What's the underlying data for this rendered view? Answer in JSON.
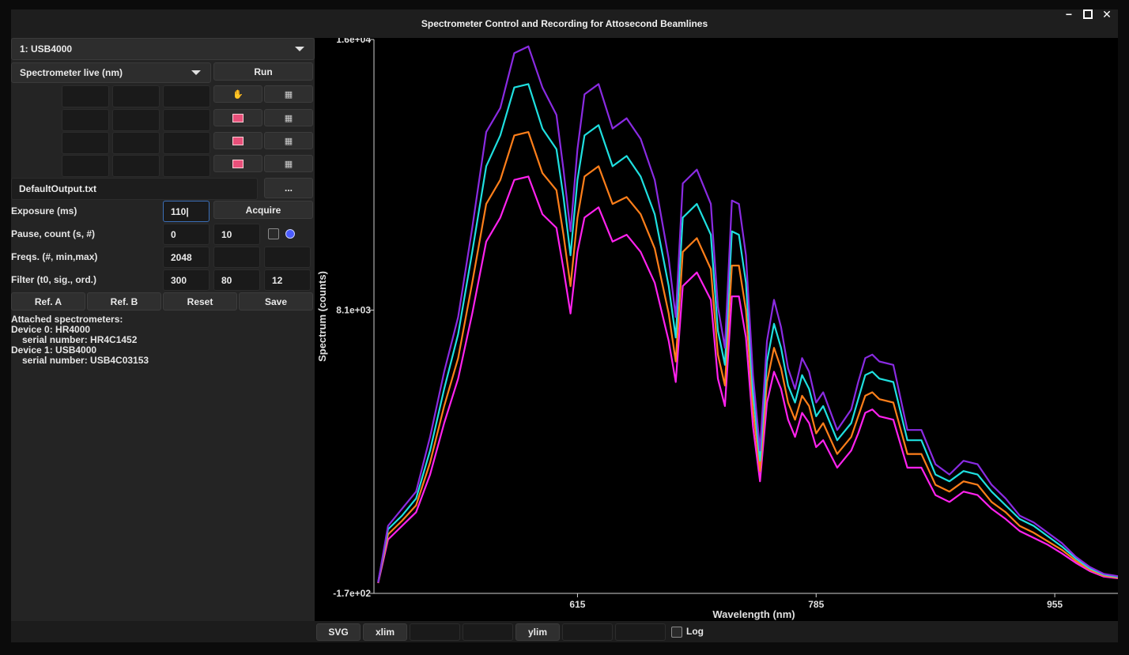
{
  "window": {
    "title": "Spectrometer Control and Recording for Attosecond Beamlines"
  },
  "device_select": {
    "value": "1: USB4000"
  },
  "mode_select": {
    "value": "Spectrometer live (nm)"
  },
  "run_label": "Run",
  "output_file": {
    "value": "DefaultOutput.txt",
    "browse_label": "..."
  },
  "exposure": {
    "label": "Exposure (ms)",
    "value": "110|",
    "acquire_label": "Acquire"
  },
  "pause": {
    "label": "Pause, count (s, #)",
    "seconds": "0",
    "count": "10"
  },
  "freqs": {
    "label": "Freqs. (#, min,max)",
    "n": "2048",
    "min": "",
    "max": ""
  },
  "filter": {
    "label": "Filter (t0, sig., ord.)",
    "t0": "300",
    "sigma": "80",
    "order": "12"
  },
  "buttons": {
    "ref_a": "Ref. A",
    "ref_b": "Ref. B",
    "reset": "Reset",
    "save": "Save"
  },
  "info": {
    "line1": "Attached spectrometers:",
    "line2": "Device 0: HR4000",
    "line3": "serial number: HR4C1452",
    "line4": "Device 1: USB4000",
    "line5": "serial number: USB4C03153"
  },
  "bottom": {
    "svg": "SVG",
    "xlim": "xlim",
    "ylim": "ylim",
    "log": "Log"
  },
  "colors": {
    "purple": "#8a2be2",
    "cyan": "#1fe0e0",
    "orange": "#ff7f1a",
    "magenta": "#ff22ee"
  },
  "chart_data": {
    "type": "line",
    "xlabel": "Wavelength (nm)",
    "ylabel": "Spectrum (counts)",
    "xlim": [
      470,
      1000
    ],
    "ylim": [
      -170,
      16000
    ],
    "x_ticks": [
      615,
      785,
      955
    ],
    "y_tick_labels": [
      "1.6e+04",
      "8.1e+03",
      "-1.7e+02"
    ],
    "y_ticks": [
      16000,
      8100,
      -170
    ],
    "x": [
      473,
      480,
      490,
      500,
      510,
      520,
      530,
      540,
      550,
      560,
      570,
      580,
      590,
      600,
      605,
      610,
      615,
      620,
      630,
      640,
      650,
      660,
      670,
      680,
      685,
      690,
      700,
      710,
      715,
      720,
      725,
      730,
      735,
      740,
      745,
      750,
      755,
      760,
      765,
      770,
      775,
      780,
      785,
      790,
      800,
      810,
      815,
      820,
      825,
      830,
      840,
      850,
      860,
      870,
      880,
      890,
      900,
      910,
      920,
      930,
      940,
      950,
      960,
      970,
      980,
      990,
      1000
    ],
    "series": [
      {
        "values": [
          150,
          1800,
          2300,
          2800,
          4400,
          6300,
          7900,
          10500,
          13300,
          14000,
          15600,
          15800,
          14600,
          13800,
          12200,
          10400,
          12800,
          14400,
          14700,
          13400,
          13700,
          13100,
          11900,
          9600,
          7900,
          11800,
          12200,
          11200,
          8200,
          7000,
          11300,
          11200,
          9700,
          6200,
          4000,
          7200,
          8400,
          7600,
          6400,
          5800,
          6700,
          6300,
          5400,
          5700,
          4600,
          5200,
          6000,
          6700,
          6800,
          6600,
          6500,
          4600,
          4600,
          3600,
          3300,
          3700,
          3600,
          3000,
          2600,
          2100,
          1900,
          1600,
          1300,
          900,
          600,
          400,
          330
        ]
      },
      {
        "values": [
          150,
          1700,
          2100,
          2600,
          4000,
          5800,
          7400,
          9800,
          12300,
          13200,
          14600,
          14700,
          13400,
          12800,
          11400,
          9700,
          11900,
          13200,
          13500,
          12300,
          12600,
          12000,
          10900,
          8800,
          7300,
          10800,
          11200,
          10300,
          7500,
          6500,
          10400,
          10300,
          8900,
          5700,
          3700,
          6600,
          7700,
          7000,
          5900,
          5400,
          6200,
          5800,
          5000,
          5300,
          4300,
          4800,
          5500,
          6200,
          6300,
          6100,
          6000,
          4300,
          4300,
          3300,
          3100,
          3400,
          3300,
          2800,
          2400,
          2000,
          1800,
          1500,
          1200,
          850,
          560,
          380,
          310
        ]
      },
      {
        "values": [
          140,
          1550,
          1950,
          2400,
          3650,
          5300,
          6700,
          8900,
          11200,
          11900,
          13200,
          13300,
          12100,
          11600,
          10300,
          8800,
          10800,
          12000,
          12300,
          11200,
          11400,
          10900,
          9900,
          8000,
          6600,
          9800,
          10200,
          9300,
          6800,
          5900,
          9400,
          9400,
          8100,
          5200,
          3400,
          6000,
          7000,
          6400,
          5400,
          4900,
          5600,
          5300,
          4500,
          4800,
          3900,
          4400,
          5000,
          5600,
          5700,
          5500,
          5400,
          3900,
          3900,
          3000,
          2800,
          3100,
          3000,
          2500,
          2200,
          1800,
          1600,
          1350,
          1100,
          780,
          520,
          350,
          290
        ]
      },
      {
        "values": [
          130,
          1400,
          1800,
          2200,
          3300,
          4800,
          6100,
          8000,
          10100,
          10800,
          11900,
          12000,
          10900,
          10500,
          9300,
          8000,
          9800,
          10800,
          11100,
          10100,
          10300,
          9800,
          8900,
          7200,
          6000,
          8800,
          9200,
          8400,
          6100,
          5300,
          8500,
          8500,
          7300,
          4700,
          3100,
          5400,
          6300,
          5800,
          4900,
          4400,
          5100,
          4800,
          4100,
          4300,
          3500,
          4000,
          4500,
          5100,
          5200,
          5000,
          4900,
          3500,
          3500,
          2700,
          2500,
          2800,
          2700,
          2300,
          2000,
          1650,
          1450,
          1250,
          1000,
          720,
          480,
          320,
          270
        ]
      }
    ]
  }
}
